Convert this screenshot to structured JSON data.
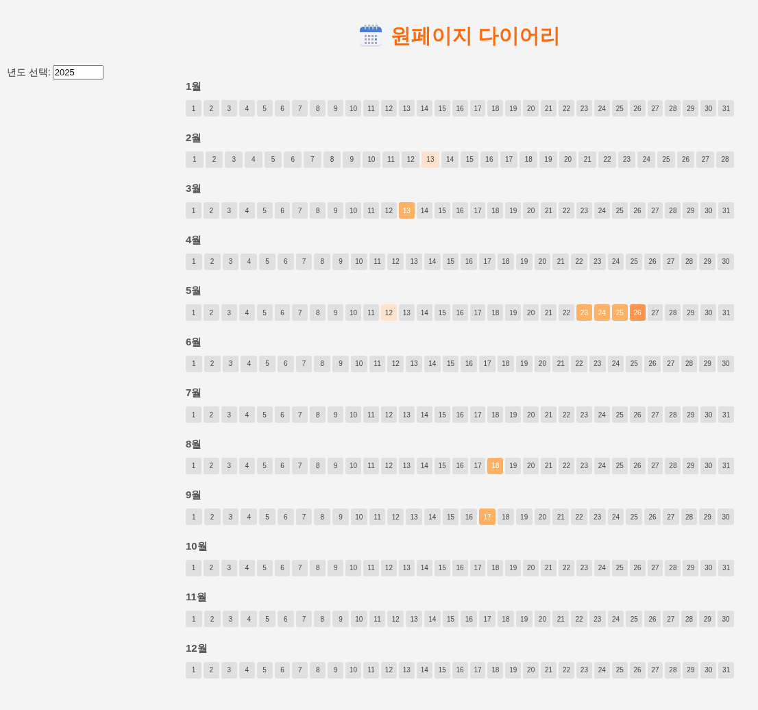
{
  "year_select": {
    "label": "년도 선택:",
    "value": "2025"
  },
  "title": "원페이지 다이어리",
  "months": [
    {
      "label": "1월",
      "days": [
        {
          "day": "1"
        },
        {
          "day": "2"
        },
        {
          "day": "3"
        },
        {
          "day": "4"
        },
        {
          "day": "5"
        },
        {
          "day": "6"
        },
        {
          "day": "7"
        },
        {
          "day": "8"
        },
        {
          "day": "9"
        },
        {
          "day": "10"
        },
        {
          "day": "11"
        },
        {
          "day": "12"
        },
        {
          "day": "13"
        },
        {
          "day": "14"
        },
        {
          "day": "15"
        },
        {
          "day": "16"
        },
        {
          "day": "17"
        },
        {
          "day": "18"
        },
        {
          "day": "19"
        },
        {
          "day": "20"
        },
        {
          "day": "21"
        },
        {
          "day": "22"
        },
        {
          "day": "23"
        },
        {
          "day": "24"
        },
        {
          "day": "25"
        },
        {
          "day": "26"
        },
        {
          "day": "27"
        },
        {
          "day": "28"
        },
        {
          "day": "29"
        },
        {
          "day": "30"
        },
        {
          "day": "31"
        }
      ]
    },
    {
      "label": "2월",
      "days": [
        {
          "day": "1"
        },
        {
          "day": "2"
        },
        {
          "day": "3"
        },
        {
          "day": "4"
        },
        {
          "day": "5"
        },
        {
          "day": "6"
        },
        {
          "day": "7"
        },
        {
          "day": "8"
        },
        {
          "day": "9"
        },
        {
          "day": "10"
        },
        {
          "day": "11"
        },
        {
          "day": "12"
        },
        {
          "day": "13",
          "color": "#ffe2ce"
        },
        {
          "day": "14"
        },
        {
          "day": "15"
        },
        {
          "day": "16"
        },
        {
          "day": "17"
        },
        {
          "day": "18"
        },
        {
          "day": "19"
        },
        {
          "day": "20"
        },
        {
          "day": "21"
        },
        {
          "day": "22"
        },
        {
          "day": "23"
        },
        {
          "day": "24"
        },
        {
          "day": "25"
        },
        {
          "day": "26"
        },
        {
          "day": "27"
        },
        {
          "day": "28"
        }
      ]
    },
    {
      "label": "3월",
      "days": [
        {
          "day": "1"
        },
        {
          "day": "2"
        },
        {
          "day": "3"
        },
        {
          "day": "4"
        },
        {
          "day": "5"
        },
        {
          "day": "6"
        },
        {
          "day": "7"
        },
        {
          "day": "8"
        },
        {
          "day": "9"
        },
        {
          "day": "10"
        },
        {
          "day": "11"
        },
        {
          "day": "12"
        },
        {
          "day": "13",
          "color": "#ffb164"
        },
        {
          "day": "14"
        },
        {
          "day": "15"
        },
        {
          "day": "16"
        },
        {
          "day": "17"
        },
        {
          "day": "18"
        },
        {
          "day": "19"
        },
        {
          "day": "20"
        },
        {
          "day": "21"
        },
        {
          "day": "22"
        },
        {
          "day": "23"
        },
        {
          "day": "24"
        },
        {
          "day": "25"
        },
        {
          "day": "26"
        },
        {
          "day": "27"
        },
        {
          "day": "28"
        },
        {
          "day": "29"
        },
        {
          "day": "30"
        },
        {
          "day": "31"
        }
      ]
    },
    {
      "label": "4월",
      "days": [
        {
          "day": "1"
        },
        {
          "day": "2"
        },
        {
          "day": "3"
        },
        {
          "day": "4"
        },
        {
          "day": "5"
        },
        {
          "day": "6"
        },
        {
          "day": "7"
        },
        {
          "day": "8"
        },
        {
          "day": "9"
        },
        {
          "day": "10"
        },
        {
          "day": "11"
        },
        {
          "day": "12"
        },
        {
          "day": "13"
        },
        {
          "day": "14"
        },
        {
          "day": "15"
        },
        {
          "day": "16"
        },
        {
          "day": "17"
        },
        {
          "day": "18"
        },
        {
          "day": "19"
        },
        {
          "day": "20"
        },
        {
          "day": "21"
        },
        {
          "day": "22"
        },
        {
          "day": "23"
        },
        {
          "day": "24"
        },
        {
          "day": "25"
        },
        {
          "day": "26"
        },
        {
          "day": "27"
        },
        {
          "day": "28"
        },
        {
          "day": "29"
        },
        {
          "day": "30"
        }
      ]
    },
    {
      "label": "5월",
      "days": [
        {
          "day": "1"
        },
        {
          "day": "2"
        },
        {
          "day": "3"
        },
        {
          "day": "4"
        },
        {
          "day": "5"
        },
        {
          "day": "6"
        },
        {
          "day": "7"
        },
        {
          "day": "8"
        },
        {
          "day": "9"
        },
        {
          "day": "10"
        },
        {
          "day": "11"
        },
        {
          "day": "12",
          "color": "#ffe2ce"
        },
        {
          "day": "13"
        },
        {
          "day": "14"
        },
        {
          "day": "15"
        },
        {
          "day": "16"
        },
        {
          "day": "17"
        },
        {
          "day": "18"
        },
        {
          "day": "19"
        },
        {
          "day": "20"
        },
        {
          "day": "21"
        },
        {
          "day": "22"
        },
        {
          "day": "23",
          "color": "#ffb164"
        },
        {
          "day": "24",
          "color": "#ffb164"
        },
        {
          "day": "25",
          "color": "#ffb164"
        },
        {
          "day": "26",
          "color": "#ff944c"
        },
        {
          "day": "27"
        },
        {
          "day": "28"
        },
        {
          "day": "29"
        },
        {
          "day": "30"
        },
        {
          "day": "31"
        }
      ]
    },
    {
      "label": "6월",
      "days": [
        {
          "day": "1"
        },
        {
          "day": "2"
        },
        {
          "day": "3"
        },
        {
          "day": "4"
        },
        {
          "day": "5"
        },
        {
          "day": "6"
        },
        {
          "day": "7"
        },
        {
          "day": "8"
        },
        {
          "day": "9"
        },
        {
          "day": "10"
        },
        {
          "day": "11"
        },
        {
          "day": "12"
        },
        {
          "day": "13"
        },
        {
          "day": "14"
        },
        {
          "day": "15"
        },
        {
          "day": "16"
        },
        {
          "day": "17"
        },
        {
          "day": "18"
        },
        {
          "day": "19"
        },
        {
          "day": "20"
        },
        {
          "day": "21"
        },
        {
          "day": "22"
        },
        {
          "day": "23"
        },
        {
          "day": "24"
        },
        {
          "day": "25"
        },
        {
          "day": "26"
        },
        {
          "day": "27"
        },
        {
          "day": "28"
        },
        {
          "day": "29"
        },
        {
          "day": "30"
        }
      ]
    },
    {
      "label": "7월",
      "days": [
        {
          "day": "1"
        },
        {
          "day": "2"
        },
        {
          "day": "3"
        },
        {
          "day": "4"
        },
        {
          "day": "5"
        },
        {
          "day": "6"
        },
        {
          "day": "7"
        },
        {
          "day": "8"
        },
        {
          "day": "9"
        },
        {
          "day": "10"
        },
        {
          "day": "11"
        },
        {
          "day": "12"
        },
        {
          "day": "13"
        },
        {
          "day": "14"
        },
        {
          "day": "15"
        },
        {
          "day": "16"
        },
        {
          "day": "17"
        },
        {
          "day": "18"
        },
        {
          "day": "19"
        },
        {
          "day": "20"
        },
        {
          "day": "21"
        },
        {
          "day": "22"
        },
        {
          "day": "23"
        },
        {
          "day": "24"
        },
        {
          "day": "25"
        },
        {
          "day": "26"
        },
        {
          "day": "27"
        },
        {
          "day": "28"
        },
        {
          "day": "29"
        },
        {
          "day": "30"
        },
        {
          "day": "31"
        }
      ]
    },
    {
      "label": "8월",
      "days": [
        {
          "day": "1"
        },
        {
          "day": "2"
        },
        {
          "day": "3"
        },
        {
          "day": "4"
        },
        {
          "day": "5"
        },
        {
          "day": "6"
        },
        {
          "day": "7"
        },
        {
          "day": "8"
        },
        {
          "day": "9"
        },
        {
          "day": "10"
        },
        {
          "day": "11"
        },
        {
          "day": "12"
        },
        {
          "day": "13"
        },
        {
          "day": "14"
        },
        {
          "day": "15"
        },
        {
          "day": "16"
        },
        {
          "day": "17"
        },
        {
          "day": "18",
          "color": "#ffb164"
        },
        {
          "day": "19"
        },
        {
          "day": "20"
        },
        {
          "day": "21"
        },
        {
          "day": "22"
        },
        {
          "day": "23"
        },
        {
          "day": "24"
        },
        {
          "day": "25"
        },
        {
          "day": "26"
        },
        {
          "day": "27"
        },
        {
          "day": "28"
        },
        {
          "day": "29"
        },
        {
          "day": "30"
        },
        {
          "day": "31"
        }
      ]
    },
    {
      "label": "9월",
      "days": [
        {
          "day": "1"
        },
        {
          "day": "2"
        },
        {
          "day": "3"
        },
        {
          "day": "4"
        },
        {
          "day": "5"
        },
        {
          "day": "6"
        },
        {
          "day": "7"
        },
        {
          "day": "8"
        },
        {
          "day": "9"
        },
        {
          "day": "10"
        },
        {
          "day": "11"
        },
        {
          "day": "12"
        },
        {
          "day": "13"
        },
        {
          "day": "14"
        },
        {
          "day": "15"
        },
        {
          "day": "16"
        },
        {
          "day": "17",
          "color": "#ffb164"
        },
        {
          "day": "18"
        },
        {
          "day": "19"
        },
        {
          "day": "20"
        },
        {
          "day": "21"
        },
        {
          "day": "22"
        },
        {
          "day": "23"
        },
        {
          "day": "24"
        },
        {
          "day": "25"
        },
        {
          "day": "26"
        },
        {
          "day": "27"
        },
        {
          "day": "28"
        },
        {
          "day": "29"
        },
        {
          "day": "30"
        }
      ]
    },
    {
      "label": "10월",
      "days": [
        {
          "day": "1"
        },
        {
          "day": "2"
        },
        {
          "day": "3"
        },
        {
          "day": "4"
        },
        {
          "day": "5"
        },
        {
          "day": "6"
        },
        {
          "day": "7"
        },
        {
          "day": "8"
        },
        {
          "day": "9"
        },
        {
          "day": "10"
        },
        {
          "day": "11"
        },
        {
          "day": "12"
        },
        {
          "day": "13"
        },
        {
          "day": "14"
        },
        {
          "day": "15"
        },
        {
          "day": "16"
        },
        {
          "day": "17"
        },
        {
          "day": "18"
        },
        {
          "day": "19"
        },
        {
          "day": "20"
        },
        {
          "day": "21"
        },
        {
          "day": "22"
        },
        {
          "day": "23"
        },
        {
          "day": "24"
        },
        {
          "day": "25"
        },
        {
          "day": "26"
        },
        {
          "day": "27"
        },
        {
          "day": "28"
        },
        {
          "day": "29"
        },
        {
          "day": "30"
        },
        {
          "day": "31"
        }
      ]
    },
    {
      "label": "11월",
      "days": [
        {
          "day": "1"
        },
        {
          "day": "2"
        },
        {
          "day": "3"
        },
        {
          "day": "4"
        },
        {
          "day": "5"
        },
        {
          "day": "6"
        },
        {
          "day": "7"
        },
        {
          "day": "8"
        },
        {
          "day": "9"
        },
        {
          "day": "10"
        },
        {
          "day": "11"
        },
        {
          "day": "12"
        },
        {
          "day": "13"
        },
        {
          "day": "14"
        },
        {
          "day": "15"
        },
        {
          "day": "16"
        },
        {
          "day": "17"
        },
        {
          "day": "18"
        },
        {
          "day": "19"
        },
        {
          "day": "20"
        },
        {
          "day": "21"
        },
        {
          "day": "22"
        },
        {
          "day": "23"
        },
        {
          "day": "24"
        },
        {
          "day": "25"
        },
        {
          "day": "26"
        },
        {
          "day": "27"
        },
        {
          "day": "28"
        },
        {
          "day": "29"
        },
        {
          "day": "30"
        }
      ]
    },
    {
      "label": "12월",
      "days": [
        {
          "day": "1"
        },
        {
          "day": "2"
        },
        {
          "day": "3"
        },
        {
          "day": "4"
        },
        {
          "day": "5"
        },
        {
          "day": "6"
        },
        {
          "day": "7"
        },
        {
          "day": "8"
        },
        {
          "day": "9"
        },
        {
          "day": "10"
        },
        {
          "day": "11"
        },
        {
          "day": "12"
        },
        {
          "day": "13"
        },
        {
          "day": "14"
        },
        {
          "day": "15"
        },
        {
          "day": "16"
        },
        {
          "day": "17"
        },
        {
          "day": "18"
        },
        {
          "day": "19"
        },
        {
          "day": "20"
        },
        {
          "day": "21"
        },
        {
          "day": "22"
        },
        {
          "day": "23"
        },
        {
          "day": "24"
        },
        {
          "day": "25"
        },
        {
          "day": "26"
        },
        {
          "day": "27"
        },
        {
          "day": "28"
        },
        {
          "day": "29"
        },
        {
          "day": "30"
        },
        {
          "day": "31"
        }
      ]
    }
  ]
}
